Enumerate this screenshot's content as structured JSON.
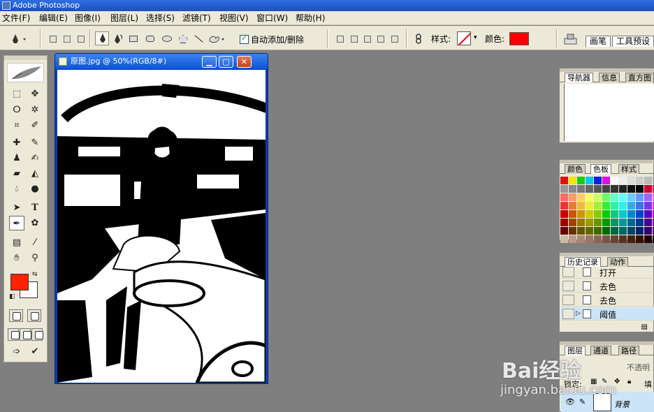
{
  "app": {
    "title": "Adobe Photoshop"
  },
  "menu": [
    {
      "label": "文件(F)"
    },
    {
      "label": "编辑(E)"
    },
    {
      "label": "图像(I)"
    },
    {
      "label": "图层(L)"
    },
    {
      "label": "选择(S)"
    },
    {
      "label": "滤镜(T)"
    },
    {
      "label": "视图(V)"
    },
    {
      "label": "窗口(W)"
    },
    {
      "label": "帮助(H)"
    }
  ],
  "options_bar": {
    "auto_add_delete_label": "自动添加/删除",
    "auto_add_delete_checked": true,
    "style_label": "样式:",
    "color_label": "颜色:",
    "color_value": "#ff0000",
    "palette_tabs": [
      "画笔",
      "工具预设"
    ]
  },
  "document": {
    "title": "原图.jpg @ 50%(RGB/8#)",
    "controls": [
      "minimize",
      "maximize",
      "close"
    ]
  },
  "toolbox": {
    "foreground_color": "#ff1a00",
    "background_color": "#ffffff"
  },
  "navigator_palette": {
    "tabs": [
      "导航器",
      "信息",
      "直方图"
    ]
  },
  "color_palette": {
    "tabs": [
      "颜色",
      "色板",
      "样式"
    ]
  },
  "history_palette": {
    "tabs": [
      "历史记录",
      "动作"
    ],
    "items": [
      {
        "label": "打开",
        "selected": false
      },
      {
        "label": "去色",
        "selected": false
      },
      {
        "label": "去色",
        "selected": false
      },
      {
        "label": "阈值",
        "selected": true
      }
    ]
  },
  "layers_palette": {
    "tabs": [
      "图层",
      "通道",
      "路径"
    ],
    "opacity_label": "不透明",
    "lock_label": "锁定:",
    "fill_label": "填",
    "layer_name": "背景"
  },
  "watermark": {
    "brand": "Bai经验",
    "url": "jingyan.baidu.com"
  }
}
